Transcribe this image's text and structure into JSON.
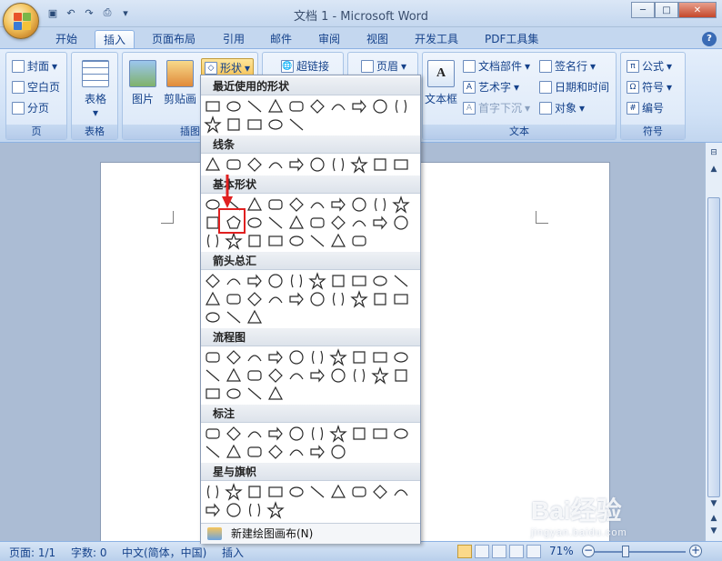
{
  "window": {
    "title": "文档 1 - Microsoft Word",
    "help": "?"
  },
  "tabs": [
    "开始",
    "插入",
    "页面布局",
    "引用",
    "邮件",
    "审阅",
    "视图",
    "开发工具",
    "PDF工具集"
  ],
  "ribbon": {
    "page_group": {
      "label": "页",
      "items": [
        "封面",
        "空白页",
        "分页"
      ]
    },
    "table_group": {
      "label": "表格",
      "button": "表格"
    },
    "illus_group": {
      "label": "插图",
      "picture": "图片",
      "clipart": "剪贴画",
      "shapes": "形状"
    },
    "links_group": {
      "hyperlink": "超链接"
    },
    "header_group": {
      "header": "页眉"
    },
    "text_group": {
      "label": "文本",
      "textbox": "文本框",
      "items": [
        "文档部件",
        "艺术字",
        "首字下沉",
        "签名行",
        "日期和时间",
        "对象"
      ]
    },
    "symbol_group": {
      "label": "符号",
      "items": [
        "公式",
        "符号",
        "编号"
      ]
    }
  },
  "gallery": {
    "sections": [
      "最近使用的形状",
      "线条",
      "基本形状",
      "箭头总汇",
      "流程图",
      "标注",
      "星与旗帜"
    ],
    "footer": "新建绘图画布(N)"
  },
  "status": {
    "page": "页面: 1/1",
    "words": "字数: 0",
    "lang": "中文(简体，中国)",
    "mode": "插入",
    "zoom": "71%"
  },
  "watermark": {
    "brand": "Bai经验",
    "url": "jingyan.baidu.com"
  },
  "colors": {
    "accent": "#15428b",
    "highlight": "#e02020"
  }
}
